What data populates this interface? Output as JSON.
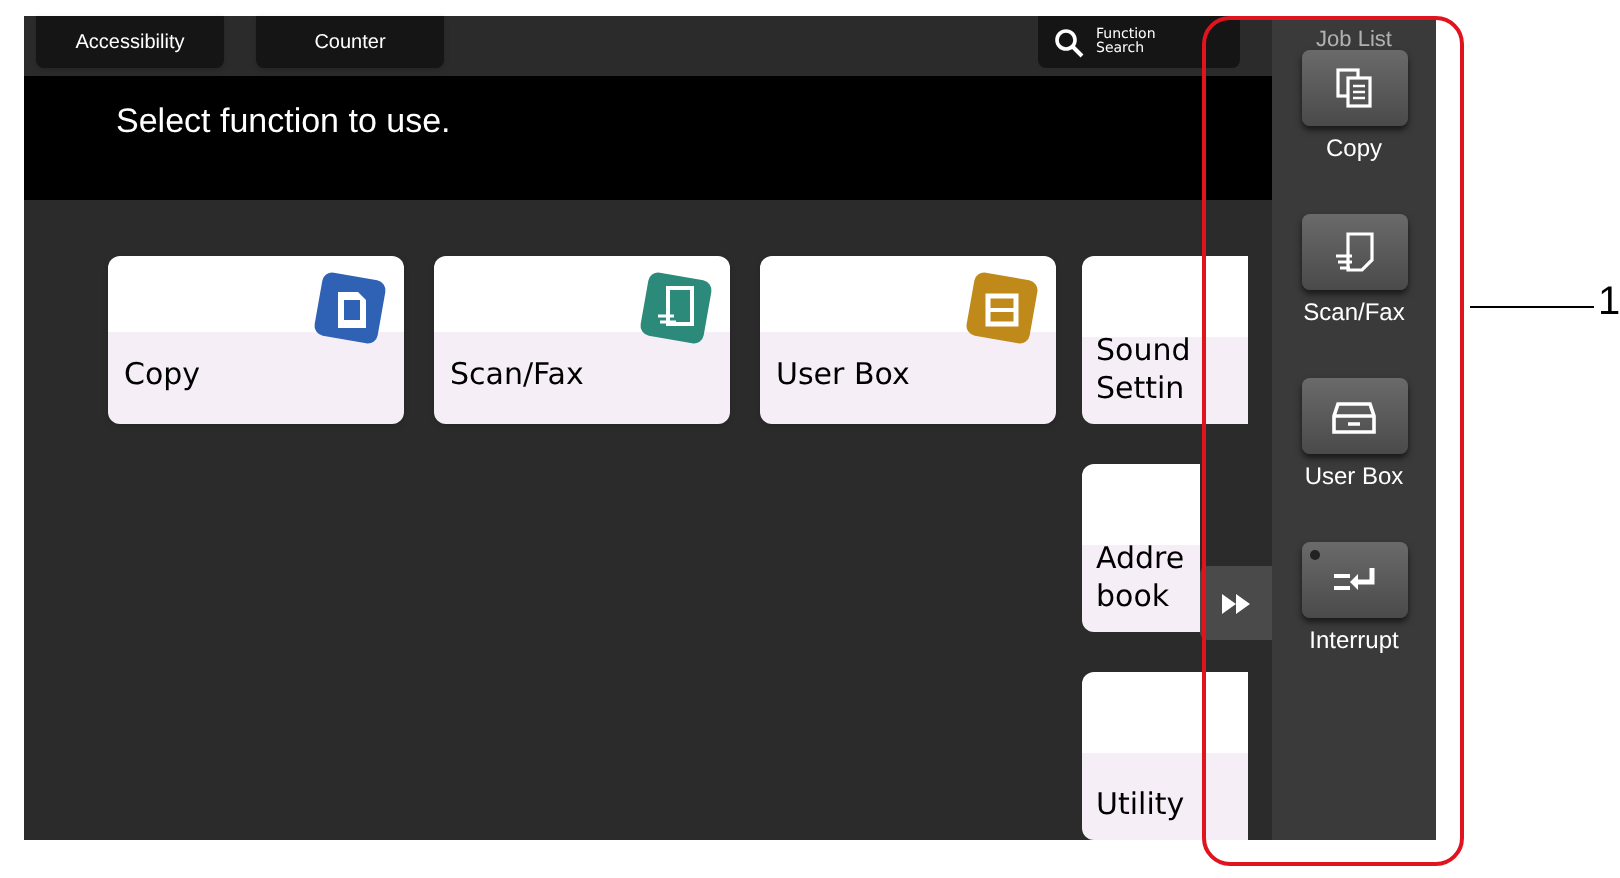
{
  "top_buttons": [
    {
      "label": "Accessibility"
    },
    {
      "label": "Counter"
    }
  ],
  "function_search": {
    "lines": [
      "Function",
      "Search"
    ]
  },
  "prompt": "Select function to use.",
  "tiles": [
    {
      "label": "Copy",
      "kind": "copy"
    },
    {
      "label": "Scan/Fax",
      "kind": "scan"
    },
    {
      "label": "User Box",
      "kind": "box"
    }
  ],
  "side_tiles": [
    {
      "label": "Sound Settin"
    },
    {
      "label": "Addre book"
    },
    {
      "label": "Utility"
    }
  ],
  "quick_panel": {
    "job_list": "Job List",
    "buttons": [
      {
        "label": "Copy",
        "kind": "copy"
      },
      {
        "label": "Scan/Fax",
        "kind": "scan"
      },
      {
        "label": "User Box",
        "kind": "box"
      },
      {
        "label": "Interrupt",
        "kind": "interrupt"
      }
    ]
  },
  "callout": {
    "number": "1"
  }
}
